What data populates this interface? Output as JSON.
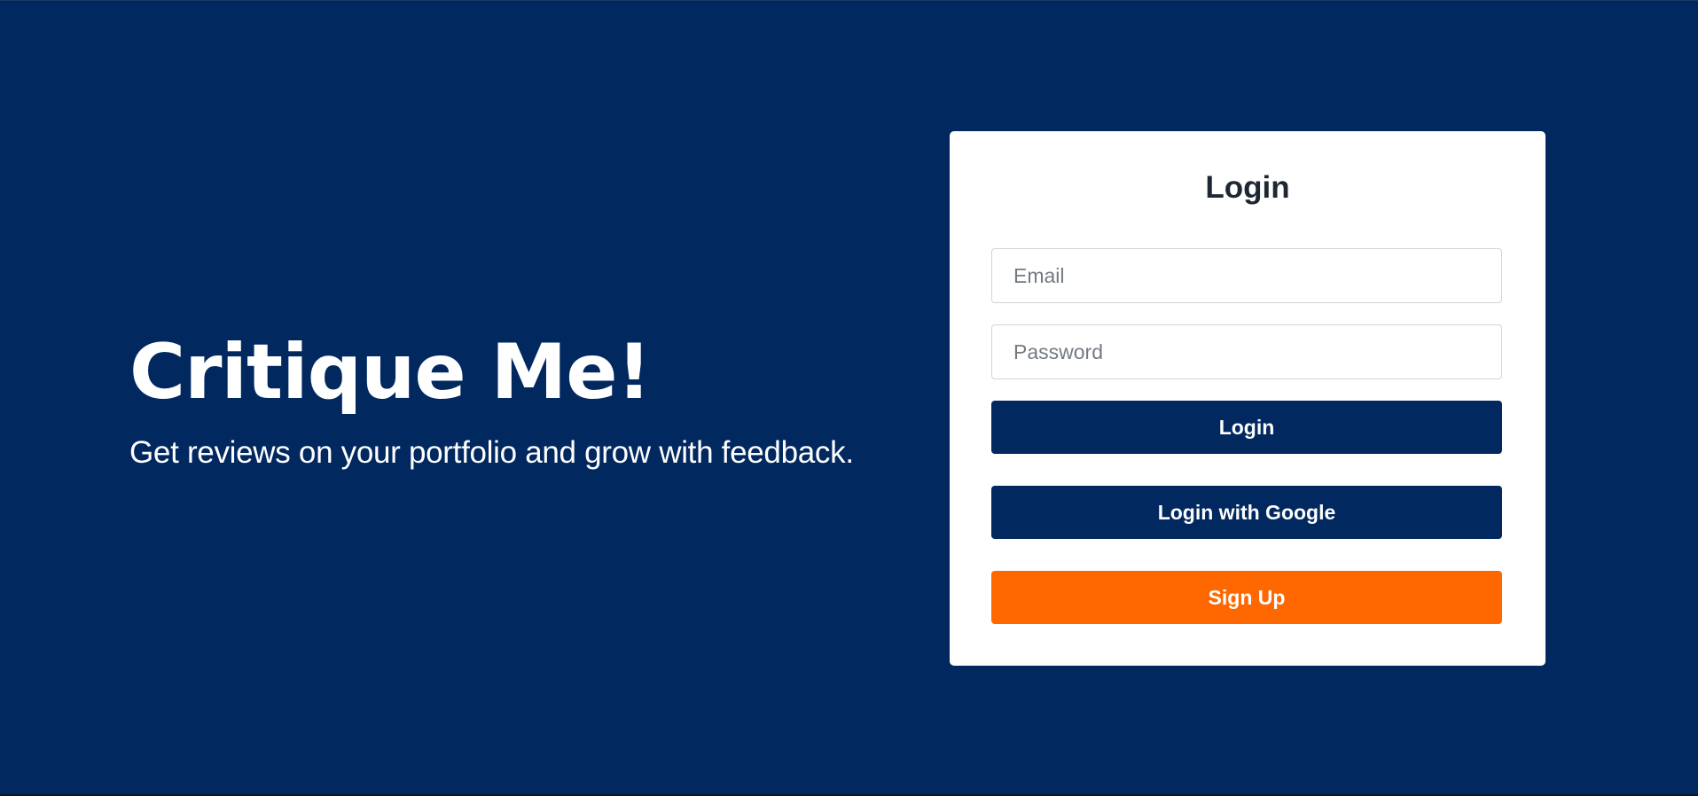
{
  "hero": {
    "title": "Critique Me!",
    "subtitle": "Get reviews on your portfolio and grow with feedback."
  },
  "login_card": {
    "title": "Login",
    "email_placeholder": "Email",
    "password_placeholder": "Password",
    "login_label": "Login",
    "google_label": "Login with Google",
    "signup_label": "Sign Up"
  },
  "colors": {
    "background": "#01285f",
    "primary_button": "#01285f",
    "accent_button": "#ff6700",
    "card": "#ffffff"
  }
}
